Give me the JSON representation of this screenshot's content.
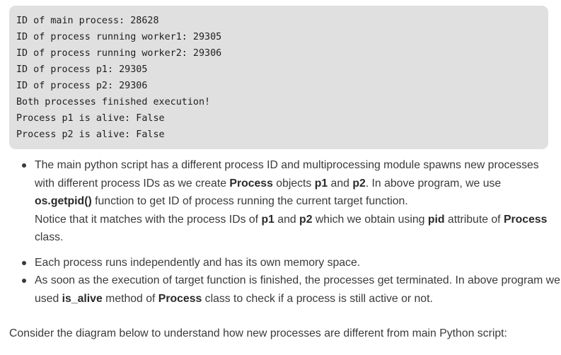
{
  "code_output": {
    "lines": [
      "ID of main process: 28628",
      "ID of process running worker1: 29305",
      "ID of process running worker2: 29306",
      "ID of process p1: 29305",
      "ID of process p2: 29306",
      "Both processes finished execution!",
      "Process p1 is alive: False",
      "Process p2 is alive: False"
    ]
  },
  "bullets": {
    "b1": {
      "t1": "The main python script has a different process ID and multiprocessing module spawns new processes with different process IDs as we create ",
      "k1": "Process",
      "t2": " objects ",
      "k2": "p1",
      "t3": " and ",
      "k3": "p2",
      "t4": ". In above program, we use ",
      "k4": "os.getpid()",
      "t5": " function to get ID of process running the current target function.",
      "t6": "Notice that it matches with the process IDs of ",
      "k5": "p1",
      "t7": " and ",
      "k6": "p2",
      "t8": " which we obtain using ",
      "k7": "pid",
      "t9": " attribute of ",
      "k8": "Process",
      "t10": " class."
    },
    "b2": {
      "text": "Each process runs independently and has its own memory space."
    },
    "b3": {
      "t1": "As soon as the execution of target function is finished, the processes get terminated. In above program we used ",
      "k1": "is_alive",
      "t2": " method of ",
      "k2": "Process",
      "t3": " class to check if a process is still active or not."
    }
  },
  "closing_text": "Consider the diagram below to understand how new processes are different from main Python script:"
}
